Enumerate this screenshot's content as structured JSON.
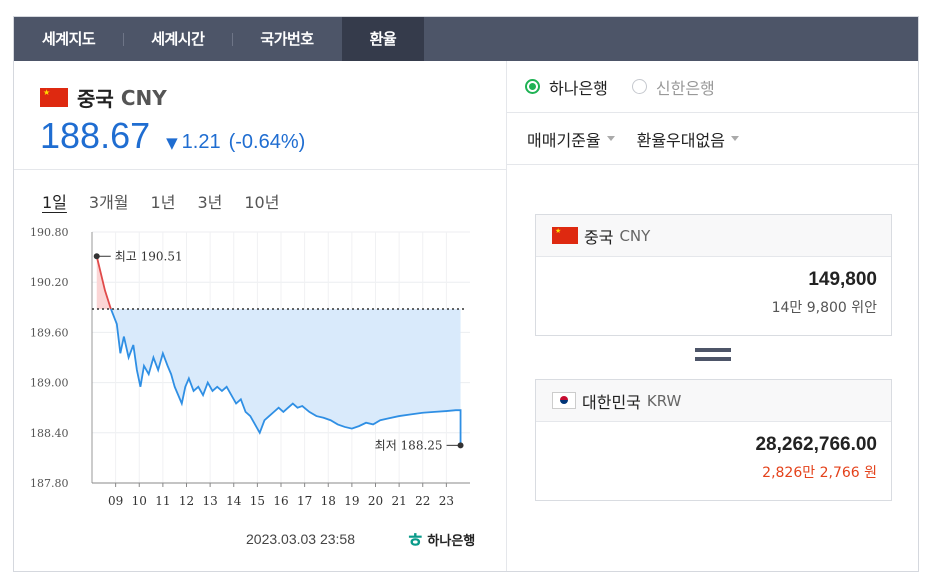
{
  "tabs": [
    {
      "label": "세계지도"
    },
    {
      "label": "세계시간"
    },
    {
      "label": "국가번호"
    },
    {
      "label": "환율",
      "active": true
    }
  ],
  "currency": {
    "name": "중국",
    "code": "CNY",
    "rate": "188.67",
    "change_direction": "down",
    "change_arrow": "▼",
    "change": "1.21",
    "change_pct": "(-0.64%)"
  },
  "periods": [
    {
      "label": "1일",
      "active": true
    },
    {
      "label": "3개월"
    },
    {
      "label": "1년"
    },
    {
      "label": "3년"
    },
    {
      "label": "10년"
    }
  ],
  "chart_data": {
    "type": "line",
    "ylim": [
      187.8,
      190.8
    ],
    "yticks": [
      "190.80",
      "190.20",
      "189.60",
      "189.00",
      "188.40",
      "187.80"
    ],
    "xticks": [
      "09",
      "10",
      "11",
      "12",
      "13",
      "14",
      "15",
      "16",
      "17",
      "18",
      "19",
      "20",
      "21",
      "22",
      "23"
    ],
    "prev_close": 189.88,
    "high_label": "최고 190.51",
    "low_label": "최저 188.25",
    "series": [
      {
        "values": [
          [
            8.2,
            190.51
          ],
          [
            8.55,
            190.1
          ],
          [
            8.8,
            189.88
          ],
          [
            9.05,
            189.7
          ],
          [
            9.2,
            189.35
          ],
          [
            9.35,
            189.55
          ],
          [
            9.55,
            189.3
          ],
          [
            9.75,
            189.45
          ],
          [
            9.9,
            189.15
          ],
          [
            10.05,
            188.95
          ],
          [
            10.2,
            189.2
          ],
          [
            10.4,
            189.1
          ],
          [
            10.6,
            189.3
          ],
          [
            10.8,
            189.15
          ],
          [
            11.0,
            189.35
          ],
          [
            11.2,
            189.2
          ],
          [
            11.35,
            189.1
          ],
          [
            11.5,
            188.95
          ],
          [
            11.65,
            188.85
          ],
          [
            11.8,
            188.75
          ],
          [
            11.95,
            188.95
          ],
          [
            12.1,
            189.05
          ],
          [
            12.3,
            188.9
          ],
          [
            12.5,
            188.95
          ],
          [
            12.7,
            188.85
          ],
          [
            12.9,
            189.0
          ],
          [
            13.1,
            188.9
          ],
          [
            13.3,
            188.95
          ],
          [
            13.5,
            188.9
          ],
          [
            13.7,
            188.95
          ],
          [
            13.9,
            188.85
          ],
          [
            14.1,
            188.75
          ],
          [
            14.3,
            188.8
          ],
          [
            14.5,
            188.65
          ],
          [
            14.7,
            188.6
          ],
          [
            14.9,
            188.5
          ],
          [
            15.1,
            188.4
          ],
          [
            15.3,
            188.55
          ],
          [
            15.5,
            188.6
          ],
          [
            15.7,
            188.65
          ],
          [
            15.9,
            188.7
          ],
          [
            16.1,
            188.65
          ],
          [
            16.3,
            188.7
          ],
          [
            16.5,
            188.75
          ],
          [
            16.7,
            188.7
          ],
          [
            16.9,
            188.72
          ],
          [
            17.2,
            188.65
          ],
          [
            17.5,
            188.6
          ],
          [
            17.8,
            188.58
          ],
          [
            18.1,
            188.55
          ],
          [
            18.4,
            188.5
          ],
          [
            18.7,
            188.47
          ],
          [
            19.0,
            188.45
          ],
          [
            19.3,
            188.48
          ],
          [
            19.6,
            188.52
          ],
          [
            19.9,
            188.5
          ],
          [
            20.2,
            188.55
          ],
          [
            20.5,
            188.57
          ],
          [
            21.0,
            188.6
          ],
          [
            21.5,
            188.62
          ],
          [
            22.0,
            188.64
          ],
          [
            22.5,
            188.65
          ],
          [
            23.0,
            188.66
          ],
          [
            23.4,
            188.67
          ],
          [
            23.6,
            188.67
          ],
          [
            23.6,
            188.25
          ]
        ]
      }
    ]
  },
  "updated": "2023.03.03 23:58",
  "logo_text": "하나은행",
  "banks": [
    {
      "label": "하나은행",
      "selected": true
    },
    {
      "label": "신한은행",
      "selected": false
    }
  ],
  "options": [
    {
      "label": "매매기준율"
    },
    {
      "label": "환율우대없음"
    }
  ],
  "from": {
    "name": "중국",
    "code": "CNY",
    "amount": "149,800",
    "words": "14만 9,800 위안"
  },
  "to": {
    "name": "대한민국",
    "code": "KRW",
    "amount": "28,262,766.00",
    "words": "2,826만 2,766 원"
  },
  "colors": {
    "tabbar": "#4d5568",
    "accent_blue": "#1f6dd1",
    "area_fill": "#d9eafb",
    "line_blue": "#2f8fe4",
    "line_red": "#e04a4a",
    "radio_green": "#1fb254",
    "red_text": "#e4421b"
  }
}
